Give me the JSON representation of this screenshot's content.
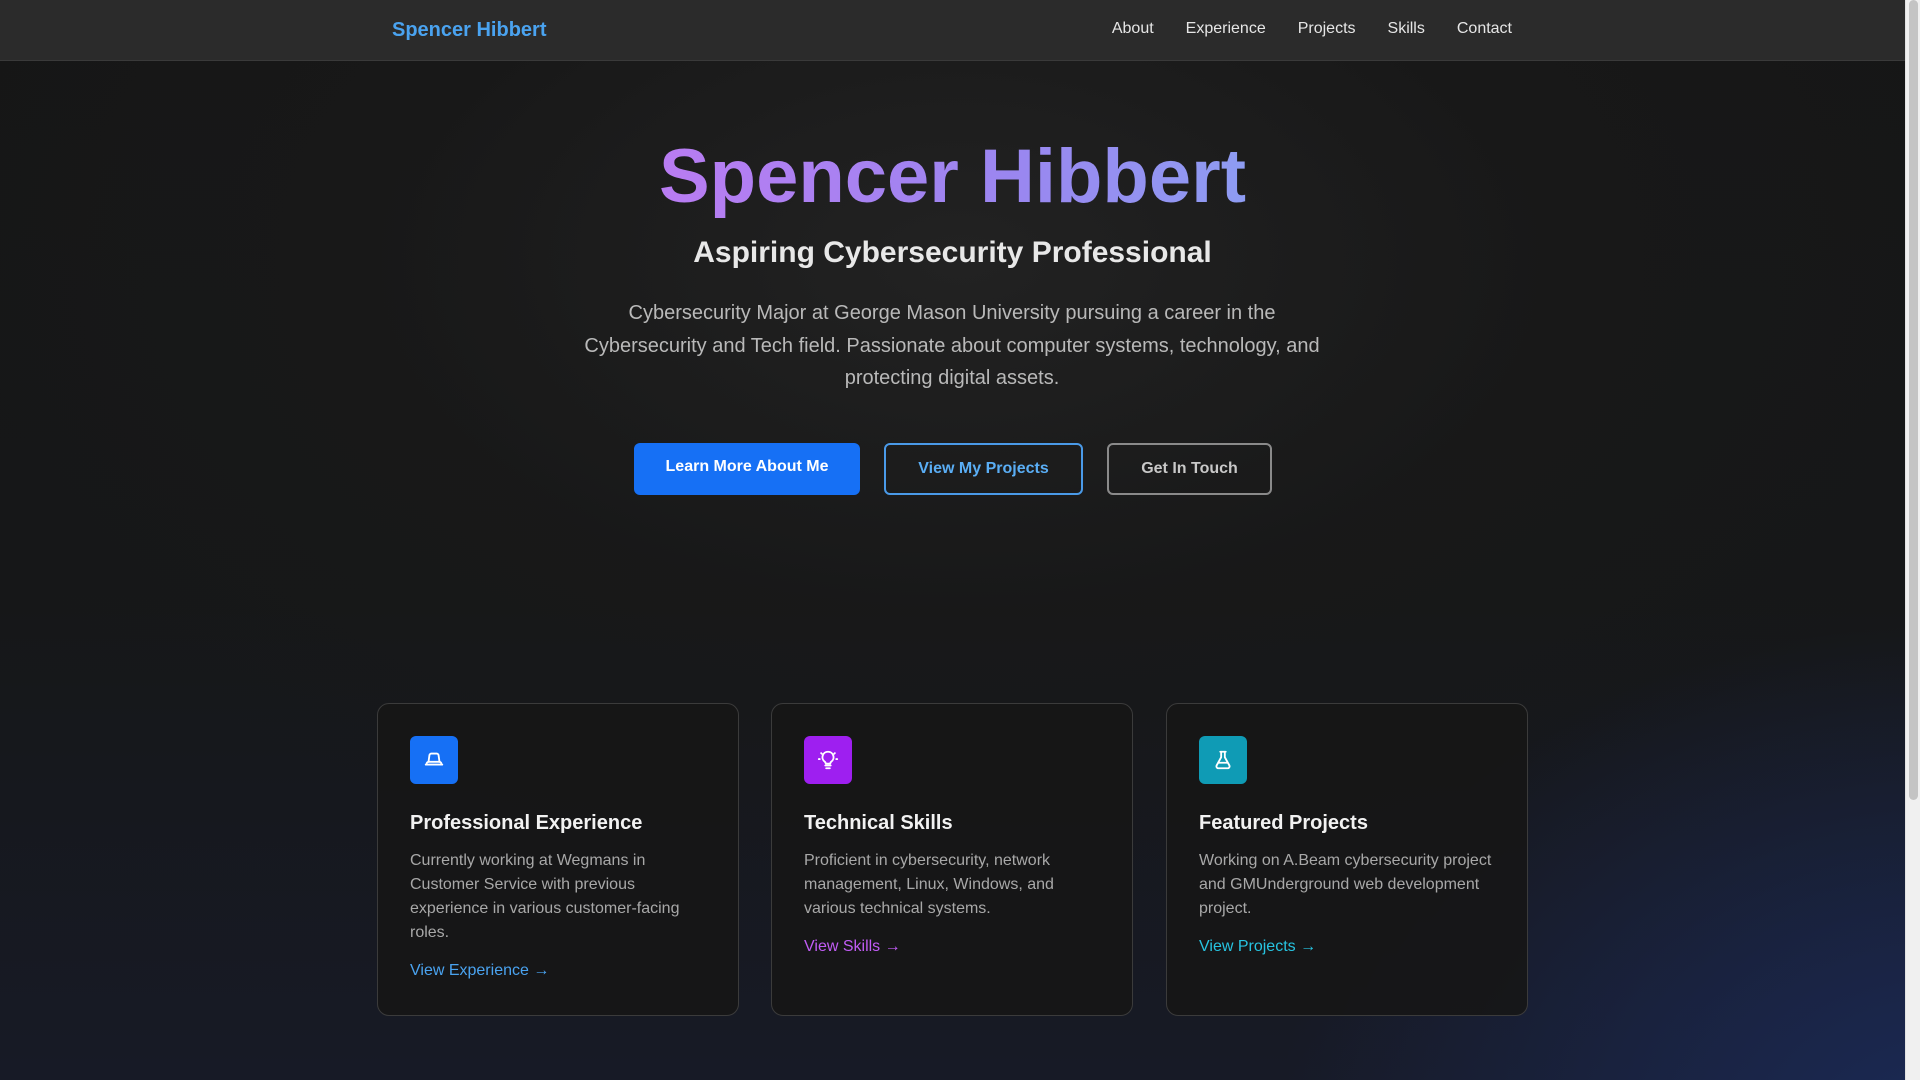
{
  "nav": {
    "brand": "Spencer Hibbert",
    "links": [
      "About",
      "Experience",
      "Projects",
      "Skills",
      "Contact"
    ]
  },
  "hero": {
    "title": "Spencer Hibbert",
    "subtitle": "Aspiring Cybersecurity Professional",
    "description": "Cybersecurity Major at George Mason University pursuing a career in the Cybersecurity and Tech field. Passionate about computer systems, technology, and protecting digital assets.",
    "buttons": {
      "primary": "Learn More About Me",
      "projects": "View My Projects",
      "contact": "Get In Touch"
    }
  },
  "cards": [
    {
      "icon": "hat-icon",
      "icon_color": "#1670f5",
      "title": "Professional Experience",
      "text": "Currently working at Wegmans in Customer Service with previous experience in various customer-facing roles.",
      "link": "View Experience →",
      "link_color": "#4aa3f0"
    },
    {
      "icon": "lightbulb-icon",
      "icon_color": "#9e1ff0",
      "title": "Technical Skills",
      "text": "Proficient in cybersecurity, network management, Linux, Windows, and various technical systems.",
      "link": "View Skills →",
      "link_color": "#c15cf5"
    },
    {
      "icon": "flask-icon",
      "icon_color": "#0f9bb5",
      "title": "Featured Projects",
      "text": "Working on A.Beam cybersecurity project and GMUnderground web development project.",
      "link": "View Projects →",
      "link_color": "#27c3e0"
    }
  ],
  "colors": {
    "brand": "#4aa3f0",
    "accent_primary": "#1670f5",
    "title_gradient_start": "#b97cf2",
    "title_gradient_end": "#8e9cf2"
  }
}
